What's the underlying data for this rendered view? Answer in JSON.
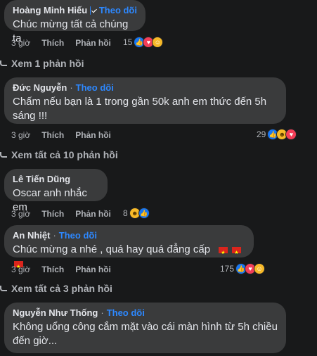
{
  "follow_label": "Theo dõi",
  "dot": "·",
  "comments": [
    {
      "author": "Hoàng Minh Hiếu",
      "verified": true,
      "follow": true,
      "text": "Chúc mừng tất cả chúng ta",
      "time": "3 giờ",
      "like": "Thích",
      "reply": "Phản hồi",
      "count": "15"
    },
    {
      "author": "Đức Nguyễn",
      "verified": false,
      "follow": true,
      "text": "Chấm nếu bạn là 1 trong gần 50k anh em thức đến 5h sáng !!!",
      "time": "3 giờ",
      "like": "Thích",
      "reply": "Phản hồi",
      "count": "29"
    },
    {
      "author": "Lê Tiến Dũng",
      "verified": false,
      "follow": false,
      "text": "Oscar anh nhắc em",
      "time": "3 giờ",
      "like": "Thích",
      "reply": "Phản hồi",
      "count": "8"
    },
    {
      "author": "An Nhiệt",
      "verified": false,
      "follow": true,
      "text": "Chúc mừng a nhé , quá hay quá đẳng cấp",
      "time": "3 giờ",
      "like": "Thích",
      "reply": "Phản hồi",
      "count": "175"
    },
    {
      "author": "Nguyễn Như Thống",
      "verified": false,
      "follow": true,
      "text": "Không uổng công cắm mặt vào cái màn hình từ 5h chiều đến giờ...",
      "time": "",
      "like": "",
      "reply": "",
      "count": ""
    }
  ],
  "view_replies": [
    "Xem 1 phản hồi",
    "Xem tất cả 10 phản hồi",
    "Xem tất cả 3 phản hồi"
  ],
  "reaction_icons": {
    "c1": [
      "like-icon",
      "heart-icon",
      "care-icon"
    ],
    "c2": [
      "like-icon",
      "haha-icon",
      "heart-icon"
    ],
    "c3": [
      "haha-icon",
      "like-icon"
    ],
    "c4": [
      "like-icon",
      "heart-icon",
      "care-icon"
    ]
  },
  "colors": {
    "background": "#18191a",
    "bubble": "#3a3b3c",
    "accent": "#2d88ff",
    "muted": "#b0b3b8"
  }
}
